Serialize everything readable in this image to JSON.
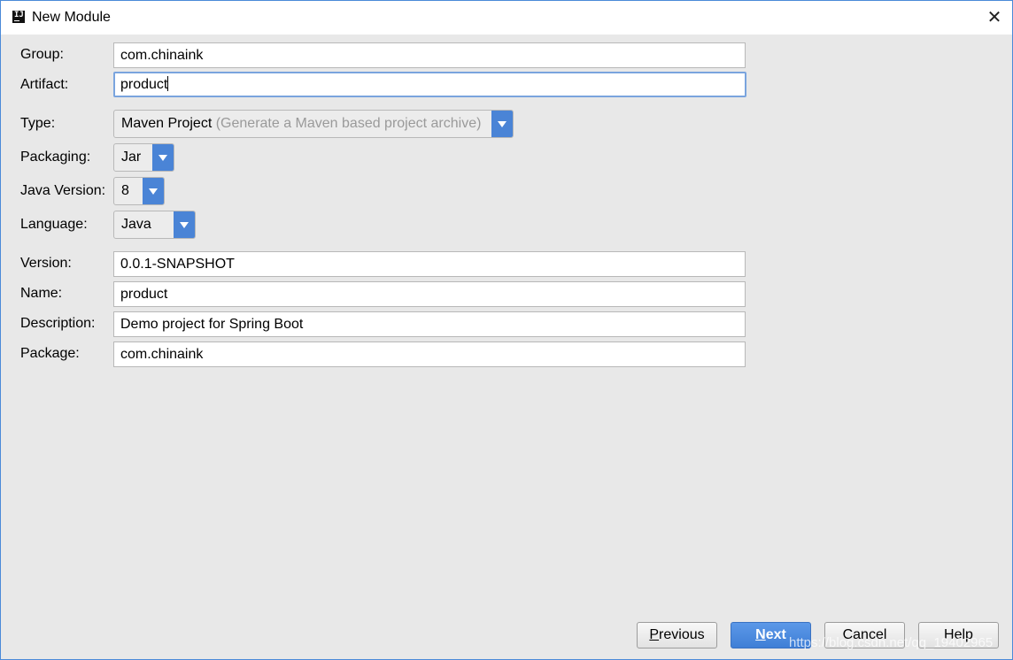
{
  "window": {
    "title": "New Module",
    "app_icon": "intellij-icon",
    "close_glyph": "✕"
  },
  "form": {
    "group": {
      "label": "Group:",
      "value": "com.chinaink"
    },
    "artifact": {
      "label": "Artifact:",
      "value": "product"
    },
    "type": {
      "label": "Type:",
      "value": "Maven Project",
      "hint": "(Generate a Maven based project archive)"
    },
    "packaging": {
      "label": "Packaging:",
      "value": "Jar"
    },
    "java_version": {
      "label": "Java Version:",
      "value": "8"
    },
    "language": {
      "label": "Language:",
      "value": "Java"
    },
    "version": {
      "label": "Version:",
      "value": "0.0.1-SNAPSHOT"
    },
    "name": {
      "label": "Name:",
      "value": "product"
    },
    "description": {
      "label": "Description:",
      "value": "Demo project for Spring Boot"
    },
    "package": {
      "label": "Package:",
      "value": "com.chinaink"
    }
  },
  "buttons": {
    "previous": {
      "mnemonic": "P",
      "rest": "revious"
    },
    "next": {
      "mnemonic": "N",
      "rest": "ext"
    },
    "cancel": "Cancel",
    "help": "Help"
  },
  "watermark": "https://blog.csdn.net/qq_19402965",
  "colors": {
    "accent": "#4a84d6",
    "window_border": "#4a8ad8",
    "background": "#e8e8e8",
    "focus_border": "#7aa4de"
  }
}
